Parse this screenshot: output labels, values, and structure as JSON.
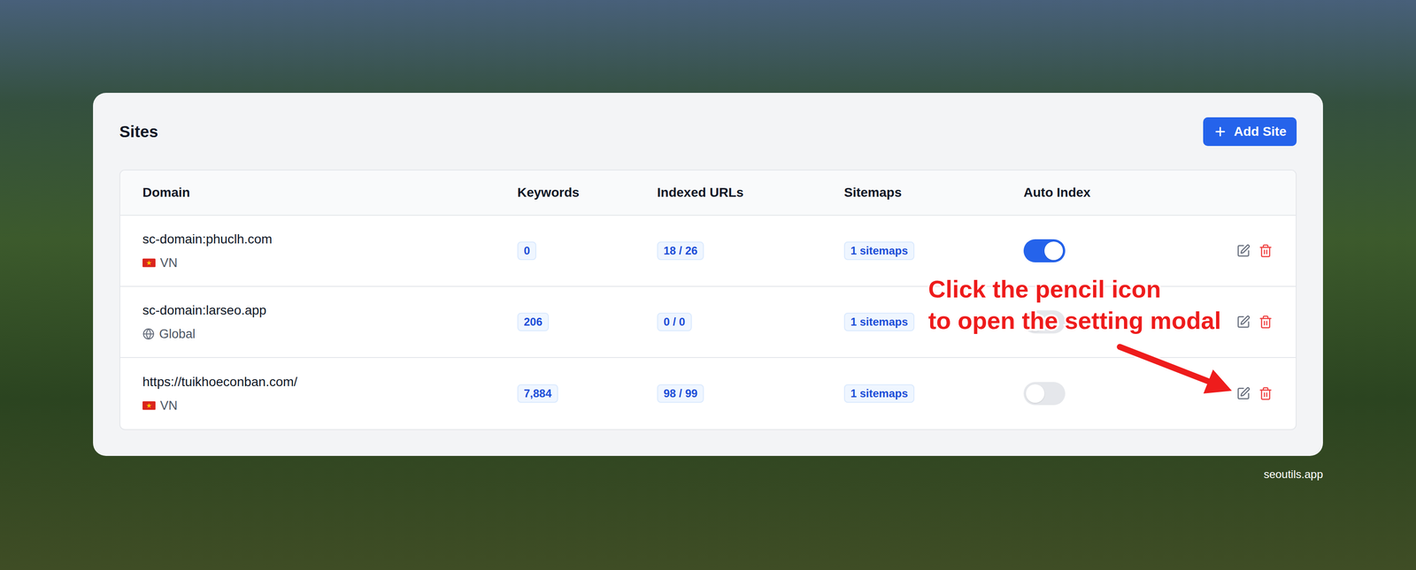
{
  "card": {
    "title": "Sites",
    "add_button": "Add Site"
  },
  "table": {
    "columns": [
      "Domain",
      "Keywords",
      "Indexed URLs",
      "Sitemaps",
      "Auto Index"
    ],
    "rows": [
      {
        "domain": "sc-domain:phuclh.com",
        "region": "VN",
        "region_kind": "flag",
        "keywords": "0",
        "indexed": "18 / 26",
        "sitemaps": "1 sitemaps",
        "auto_index": true
      },
      {
        "domain": "sc-domain:larseo.app",
        "region": "Global",
        "region_kind": "globe",
        "keywords": "206",
        "indexed": "0 / 0",
        "sitemaps": "1 sitemaps",
        "auto_index": false
      },
      {
        "domain": "https://tuikhoeconban.com/",
        "region": "VN",
        "region_kind": "flag",
        "keywords": "7,884",
        "indexed": "98 / 99",
        "sitemaps": "1 sitemaps",
        "auto_index": false
      }
    ]
  },
  "annotation": {
    "lines": [
      "Click the pencil icon",
      "to open the setting modal"
    ]
  },
  "watermark": "seoutils.app"
}
